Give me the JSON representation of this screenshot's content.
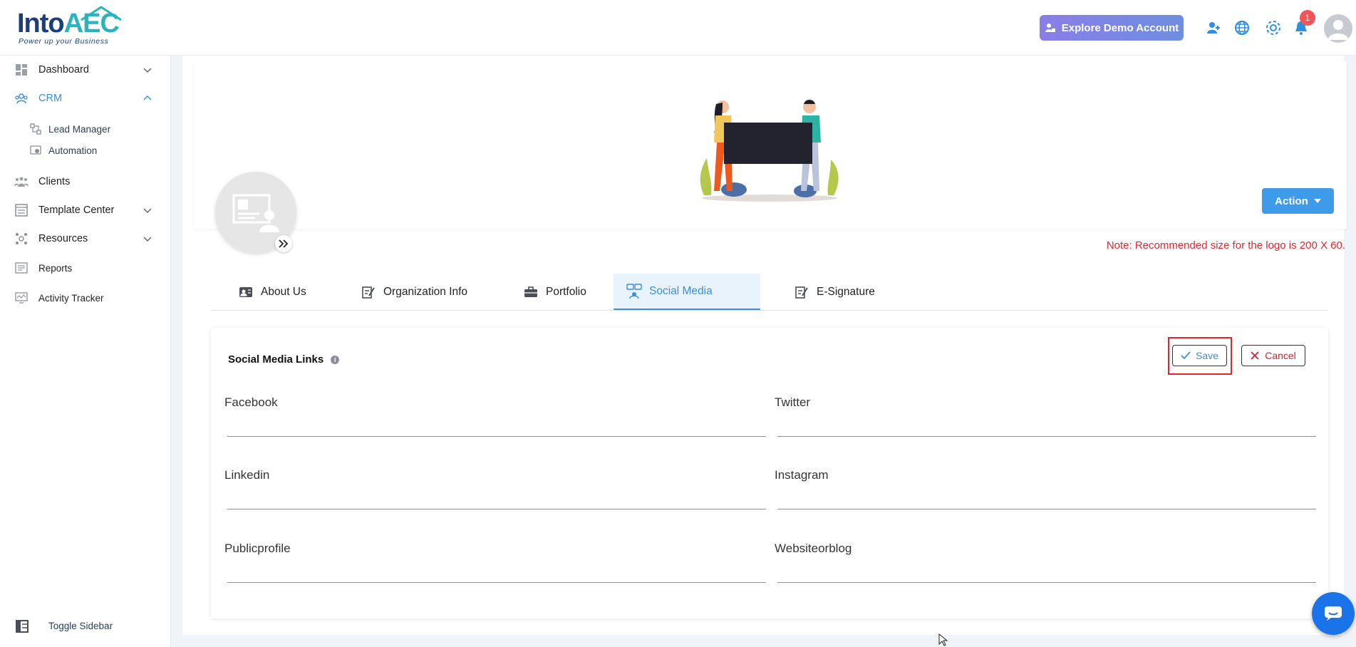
{
  "app": {
    "logo_main": "Into",
    "logo_accent": "AEC",
    "tagline": "Power up your Business"
  },
  "header": {
    "demo_button": "Explore Demo Account",
    "notification_count": "1"
  },
  "sidebar": {
    "items": [
      {
        "label": "Dashboard",
        "icon": "dashboard-icon",
        "expandable": true
      },
      {
        "label": "CRM",
        "icon": "crm-icon",
        "expandable": true,
        "active": true
      },
      {
        "label": "Lead Manager",
        "icon": "lead-manager-icon",
        "sub": true
      },
      {
        "label": "Automation",
        "icon": "automation-icon",
        "sub": true
      },
      {
        "label": "Clients",
        "icon": "clients-icon"
      },
      {
        "label": "Template Center",
        "icon": "template-icon",
        "expandable": true
      },
      {
        "label": "Resources",
        "icon": "resources-icon",
        "expandable": true
      },
      {
        "label": "Reports",
        "icon": "reports-icon"
      },
      {
        "label": "Activity Tracker",
        "icon": "activity-icon"
      }
    ],
    "toggle_label": "Toggle Sidebar"
  },
  "profile": {
    "action_button": "Action",
    "note": "Note: Recommended size for the logo is 200 X 60."
  },
  "tabs": [
    {
      "label": "About Us",
      "icon": "id-card-icon"
    },
    {
      "label": "Organization Info",
      "icon": "edit-doc-icon"
    },
    {
      "label": "Portfolio",
      "icon": "briefcase-icon"
    },
    {
      "label": "Social Media",
      "icon": "social-icon",
      "active": true
    },
    {
      "label": "E-Signature",
      "icon": "signature-icon"
    }
  ],
  "social": {
    "title": "Social Media Links",
    "save": "Save",
    "cancel": "Cancel",
    "fields": [
      {
        "label": "Facebook",
        "value": ""
      },
      {
        "label": "Twitter",
        "value": ""
      },
      {
        "label": "Linkedin",
        "value": ""
      },
      {
        "label": "Instagram",
        "value": ""
      },
      {
        "label": "Publicprofile",
        "value": ""
      },
      {
        "label": "Websiteorblog",
        "value": ""
      }
    ]
  },
  "colors": {
    "primary": "#3c8fd8",
    "danger": "#e0272f",
    "action": "#3d9be9",
    "chat": "#1a73e8"
  }
}
